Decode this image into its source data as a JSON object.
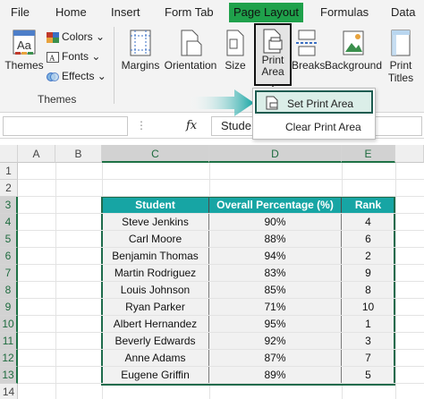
{
  "ribbon_tabs": [
    "File",
    "Home",
    "Insert",
    "Form Tab",
    "Page Layout",
    "Formulas",
    "Data"
  ],
  "active_tab": "Page Layout",
  "themes_group": {
    "themes_label": "Themes",
    "colors_label": "Colors",
    "fonts_label": "Fonts",
    "effects_label": "Effects",
    "group_label": "Themes"
  },
  "page_setup": {
    "margins": "Margins",
    "orientation": "Orientation",
    "size": "Size",
    "print_area_line1": "Print",
    "print_area_line2": "Area",
    "breaks": "Breaks",
    "background": "Background",
    "print_titles_line1": "Print",
    "print_titles_line2": "Titles"
  },
  "print_area_menu": {
    "set": "Set Print Area",
    "clear": "Clear Print Area"
  },
  "formula_bar": {
    "fx": "fx",
    "value": "Stude"
  },
  "columns": [
    "A",
    "B",
    "C",
    "D",
    "E"
  ],
  "rows": [
    "1",
    "2",
    "3",
    "4",
    "5",
    "6",
    "7",
    "8",
    "9",
    "10",
    "11",
    "12",
    "13",
    "14"
  ],
  "table": {
    "headers": [
      "Student",
      "Overall Percentage (%)",
      "Rank"
    ],
    "rows": [
      [
        "Steve Jenkins",
        "90%",
        "4"
      ],
      [
        "Carl Moore",
        "88%",
        "6"
      ],
      [
        "Benjamin Thomas",
        "94%",
        "2"
      ],
      [
        "Martin Rodriguez",
        "83%",
        "9"
      ],
      [
        "Louis Johnson",
        "85%",
        "8"
      ],
      [
        "Ryan Parker",
        "71%",
        "10"
      ],
      [
        "Albert Hernandez",
        "95%",
        "1"
      ],
      [
        "Beverly Edwards",
        "92%",
        "3"
      ],
      [
        "Anne Adams",
        "87%",
        "7"
      ],
      [
        "Eugene Griffin",
        "89%",
        "5"
      ]
    ]
  },
  "colors": {
    "accent_green": "#1fa14b",
    "table_header": "#17a5a4",
    "highlight_border": "#1d5b50"
  }
}
